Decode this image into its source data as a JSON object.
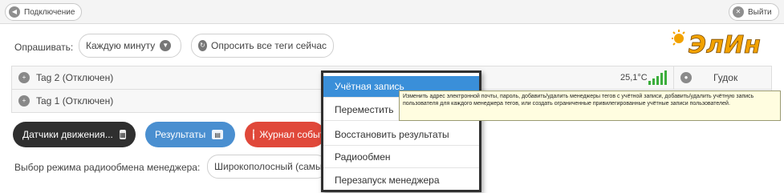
{
  "topbar": {
    "connect_label": "Подключение",
    "logout_label": "Выйти"
  },
  "poll": {
    "label": "Опрашивать:",
    "interval_value": "Каждую минуту",
    "poll_all_label": "Опросить все теги сейчас"
  },
  "brand": {
    "logo_text": "ЭлИн"
  },
  "tags": [
    {
      "name": "Tag 2 (Отключен)",
      "temperature": "25,1°C",
      "action_label": "Гудок"
    },
    {
      "name": "Tag 1 (Отключен)"
    }
  ],
  "buttons": {
    "motion_sensors": "Датчики движения...",
    "results": "Результаты",
    "event_log": "Журнал событий"
  },
  "radio_mode": {
    "label": "Выбор режима радиообмена менеджера:",
    "value": "Широкополосный (самый"
  },
  "menu": {
    "items": [
      "Учётная запись",
      "Переместить",
      "Восстановить результаты",
      "Радиообмен",
      "Перезапуск менеджера"
    ]
  },
  "tooltip": {
    "text": "Изменить адрес электронной почты, пароль, добавить/удалить менеджеры тегов с учётной записи, добавить/удалить учётную запись пользователя для каждого менеджера тегов, или создать ограниченные привилегированные учётные записи пользователей."
  },
  "colors": {
    "menu_active": "#3a8fd9",
    "btn_dark": "#2f2f2f",
    "btn_blue": "#4a8fd0",
    "btn_red": "#e0483a",
    "logo_orange": "#f2a200",
    "signal_green": "#3cae3c"
  }
}
